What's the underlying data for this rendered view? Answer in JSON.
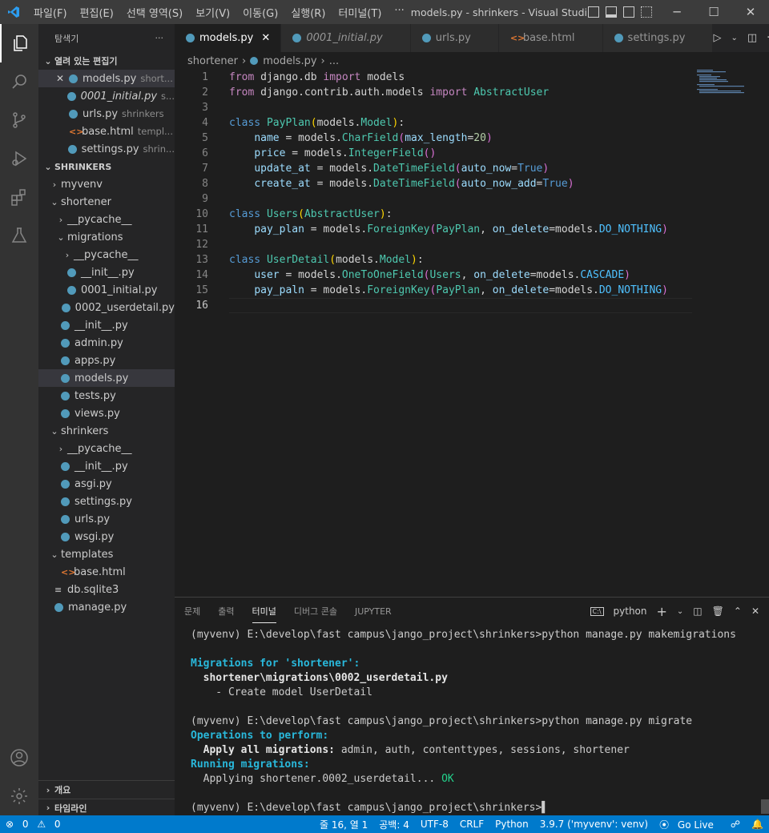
{
  "titlebar": {
    "menus": [
      "파일(F)",
      "편집(E)",
      "선택 영역(S)",
      "보기(V)",
      "이동(G)",
      "실행(R)",
      "터미널(T)",
      "···"
    ],
    "title": "models.py - shrinkers - Visual Studi..."
  },
  "sidebar": {
    "title": "탐색기",
    "open_editors_label": "열려 있는 편집기",
    "open_editors": [
      {
        "name": "models.py",
        "desc": "short...",
        "type": "py",
        "close": true
      },
      {
        "name": "0001_initial.py",
        "desc": "s...",
        "type": "py",
        "italic": true
      },
      {
        "name": "urls.py",
        "desc": "shrinkers",
        "type": "py"
      },
      {
        "name": "base.html",
        "desc": "templ...",
        "type": "html"
      },
      {
        "name": "settings.py",
        "desc": "shrin...",
        "type": "py"
      }
    ],
    "project_label": "SHRINKERS",
    "tree": [
      {
        "name": "myvenv",
        "type": "folder",
        "open": false,
        "indent": 1
      },
      {
        "name": "shortener",
        "type": "folder",
        "open": true,
        "indent": 1
      },
      {
        "name": "__pycache__",
        "type": "folder",
        "open": false,
        "indent": 2
      },
      {
        "name": "migrations",
        "type": "folder",
        "open": true,
        "indent": 2
      },
      {
        "name": "__pycache__",
        "type": "folder",
        "open": false,
        "indent": 3
      },
      {
        "name": "__init__.py",
        "type": "py",
        "indent": 3
      },
      {
        "name": "0001_initial.py",
        "type": "py",
        "indent": 3
      },
      {
        "name": "0002_userdetail.py",
        "type": "py",
        "indent": 3
      },
      {
        "name": "__init__.py",
        "type": "py",
        "indent": 2
      },
      {
        "name": "admin.py",
        "type": "py",
        "indent": 2
      },
      {
        "name": "apps.py",
        "type": "py",
        "indent": 2
      },
      {
        "name": "models.py",
        "type": "py",
        "indent": 2,
        "selected": true
      },
      {
        "name": "tests.py",
        "type": "py",
        "indent": 2
      },
      {
        "name": "views.py",
        "type": "py",
        "indent": 2
      },
      {
        "name": "shrinkers",
        "type": "folder",
        "open": true,
        "indent": 1
      },
      {
        "name": "__pycache__",
        "type": "folder",
        "open": false,
        "indent": 2
      },
      {
        "name": "__init__.py",
        "type": "py",
        "indent": 2
      },
      {
        "name": "asgi.py",
        "type": "py",
        "indent": 2
      },
      {
        "name": "settings.py",
        "type": "py",
        "indent": 2
      },
      {
        "name": "urls.py",
        "type": "py",
        "indent": 2
      },
      {
        "name": "wsgi.py",
        "type": "py",
        "indent": 2
      },
      {
        "name": "templates",
        "type": "folder",
        "open": true,
        "indent": 1
      },
      {
        "name": "base.html",
        "type": "html",
        "indent": 2
      },
      {
        "name": "db.sqlite3",
        "type": "db",
        "indent": 1
      },
      {
        "name": "manage.py",
        "type": "py",
        "indent": 1
      }
    ],
    "outline_label": "개요",
    "timeline_label": "타임라인"
  },
  "tabs": [
    {
      "label": "models.py",
      "active": true,
      "type": "py"
    },
    {
      "label": "0001_initial.py",
      "italic": true,
      "type": "py"
    },
    {
      "label": "urls.py",
      "type": "py"
    },
    {
      "label": "base.html",
      "type": "html"
    },
    {
      "label": "settings.py",
      "type": "py"
    }
  ],
  "breadcrumb": {
    "folder": "shortener",
    "file": "models.py",
    "more": "..."
  },
  "editor": {
    "current_line": 16,
    "lines": [
      [
        [
          "kw",
          "from"
        ],
        [
          "t",
          " django.db "
        ],
        [
          "kw",
          "import"
        ],
        [
          "t",
          " models"
        ]
      ],
      [
        [
          "kw",
          "from"
        ],
        [
          "t",
          " django.contrib.auth.models "
        ],
        [
          "kw",
          "import"
        ],
        [
          "t",
          " "
        ],
        [
          "c",
          "AbstractUser"
        ]
      ],
      [],
      [
        [
          "k",
          "class"
        ],
        [
          "t",
          " "
        ],
        [
          "c",
          "PayPlan"
        ],
        [
          "p1",
          "("
        ],
        [
          "t",
          "models."
        ],
        [
          "c",
          "Model"
        ],
        [
          "p1",
          ")"
        ],
        [
          "t",
          ":"
        ]
      ],
      [
        [
          "t",
          "    "
        ],
        [
          "v",
          "name"
        ],
        [
          "t",
          " = models."
        ],
        [
          "c",
          "CharField"
        ],
        [
          "p2",
          "("
        ],
        [
          "v",
          "max_length"
        ],
        [
          "t",
          "="
        ],
        [
          "n",
          "20"
        ],
        [
          "p2",
          ")"
        ]
      ],
      [
        [
          "t",
          "    "
        ],
        [
          "v",
          "price"
        ],
        [
          "t",
          " = models."
        ],
        [
          "c",
          "IntegerField"
        ],
        [
          "p2",
          "()"
        ]
      ],
      [
        [
          "t",
          "    "
        ],
        [
          "v",
          "update_at"
        ],
        [
          "t",
          " = models."
        ],
        [
          "c",
          "DateTimeField"
        ],
        [
          "p2",
          "("
        ],
        [
          "v",
          "auto_now"
        ],
        [
          "t",
          "="
        ],
        [
          "b",
          "True"
        ],
        [
          "p2",
          ")"
        ]
      ],
      [
        [
          "t",
          "    "
        ],
        [
          "v",
          "create_at"
        ],
        [
          "t",
          " = models."
        ],
        [
          "c",
          "DateTimeField"
        ],
        [
          "p2",
          "("
        ],
        [
          "v",
          "auto_now_add"
        ],
        [
          "t",
          "="
        ],
        [
          "b",
          "True"
        ],
        [
          "p2",
          ")"
        ]
      ],
      [],
      [
        [
          "k",
          "class"
        ],
        [
          "t",
          " "
        ],
        [
          "c",
          "Users"
        ],
        [
          "p1",
          "("
        ],
        [
          "c",
          "AbstractUser"
        ],
        [
          "p1",
          ")"
        ],
        [
          "t",
          ":"
        ]
      ],
      [
        [
          "t",
          "    "
        ],
        [
          "v",
          "pay_plan"
        ],
        [
          "t",
          " = models."
        ],
        [
          "c",
          "ForeignKey"
        ],
        [
          "p2",
          "("
        ],
        [
          "c",
          "PayPlan"
        ],
        [
          "t",
          ", "
        ],
        [
          "v",
          "on_delete"
        ],
        [
          "t",
          "=models."
        ],
        [
          "cn",
          "DO_NOTHING"
        ],
        [
          "p2",
          ")"
        ]
      ],
      [],
      [
        [
          "k",
          "class"
        ],
        [
          "t",
          " "
        ],
        [
          "c",
          "UserDetail"
        ],
        [
          "p1",
          "("
        ],
        [
          "t",
          "models."
        ],
        [
          "c",
          "Model"
        ],
        [
          "p1",
          ")"
        ],
        [
          "t",
          ":"
        ]
      ],
      [
        [
          "t",
          "    "
        ],
        [
          "v",
          "user"
        ],
        [
          "t",
          " = models."
        ],
        [
          "c",
          "OneToOneField"
        ],
        [
          "p2",
          "("
        ],
        [
          "c",
          "Users"
        ],
        [
          "t",
          ", "
        ],
        [
          "v",
          "on_delete"
        ],
        [
          "t",
          "=models."
        ],
        [
          "cn",
          "CASCADE"
        ],
        [
          "p2",
          ")"
        ]
      ],
      [
        [
          "t",
          "    "
        ],
        [
          "v",
          "pay_paln"
        ],
        [
          "t",
          " = models."
        ],
        [
          "c",
          "ForeignKey"
        ],
        [
          "p2",
          "("
        ],
        [
          "c",
          "PayPlan"
        ],
        [
          "t",
          ", "
        ],
        [
          "v",
          "on_delete"
        ],
        [
          "t",
          "=models."
        ],
        [
          "cn",
          "DO_NOTHING"
        ],
        [
          "p2",
          ")"
        ]
      ],
      []
    ]
  },
  "panel": {
    "tabs": [
      "문제",
      "출력",
      "터미널",
      "디버그 콘솔",
      "JUPYTER"
    ],
    "active_tab": "터미널",
    "shell": "python",
    "terminal": [
      [
        [
          "t",
          "(myvenv) E:\\develop\\fast campus\\jango_project\\shrinkers>python manage.py makemigrations"
        ]
      ],
      [],
      [
        [
          "cy",
          "Migrations for 'shortener':"
        ]
      ],
      [
        [
          "bo",
          "  shortener\\migrations\\0002_userdetail.py"
        ]
      ],
      [
        [
          "t",
          "    - Create model UserDetail"
        ]
      ],
      [],
      [
        [
          "t",
          "(myvenv) E:\\develop\\fast campus\\jango_project\\shrinkers>python manage.py migrate"
        ]
      ],
      [
        [
          "cy",
          "Operations to perform:"
        ]
      ],
      [
        [
          "bo",
          "  Apply all migrations:"
        ],
        [
          "t",
          " admin, auth, contenttypes, sessions, shortener"
        ]
      ],
      [
        [
          "cy",
          "Running migrations:"
        ]
      ],
      [
        [
          "t",
          "  Applying shortener.0002_userdetail... "
        ],
        [
          "gr",
          "OK"
        ]
      ],
      [],
      [
        [
          "t",
          "(myvenv) E:\\develop\\fast campus\\jango_project\\shrinkers>"
        ],
        [
          "cursor",
          "▌"
        ]
      ]
    ]
  },
  "statusbar": {
    "errors": "0",
    "warnings": "0",
    "position": "줄 16, 열 1",
    "spaces": "공백: 4",
    "encoding": "UTF-8",
    "eol": "CRLF",
    "language": "Python",
    "interpreter": "3.9.7 ('myvenv': venv)",
    "golive": "Go Live"
  }
}
